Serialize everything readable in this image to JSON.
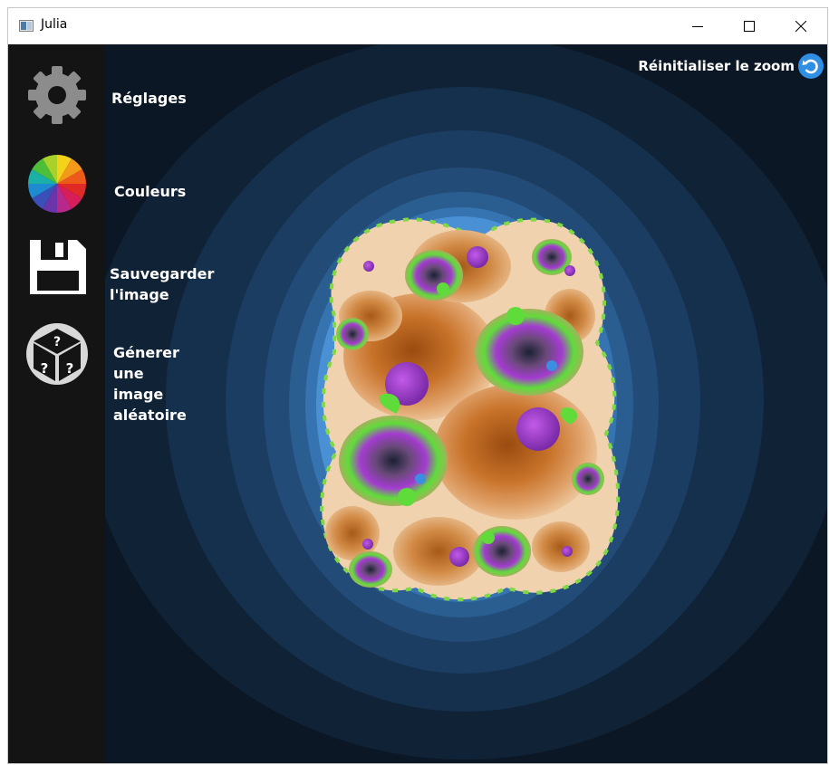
{
  "window": {
    "title": "Julia"
  },
  "menu": {
    "items": [
      {
        "label": "Réglages",
        "icon": "gear-icon"
      },
      {
        "label": "Couleurs",
        "icon": "color-wheel-icon"
      },
      {
        "label": "Sauvegarder l'image",
        "icon": "floppy-disk-icon"
      },
      {
        "label": "Génerer une image\naléatoire",
        "icon": "dice-icon"
      }
    ]
  },
  "toolbar": {
    "reset_zoom_label": "Réinitialiser le zoom",
    "reset_zoom_icon": "reset-arrow-icon"
  },
  "colors": {
    "sidebar": "#141414",
    "canvas_background": "#0c1725",
    "accent_blue": "#2f8fe4",
    "fractal_orange": "#c8732a",
    "fractal_purple": "#a43bd1",
    "fractal_green": "#5fdc3a"
  }
}
